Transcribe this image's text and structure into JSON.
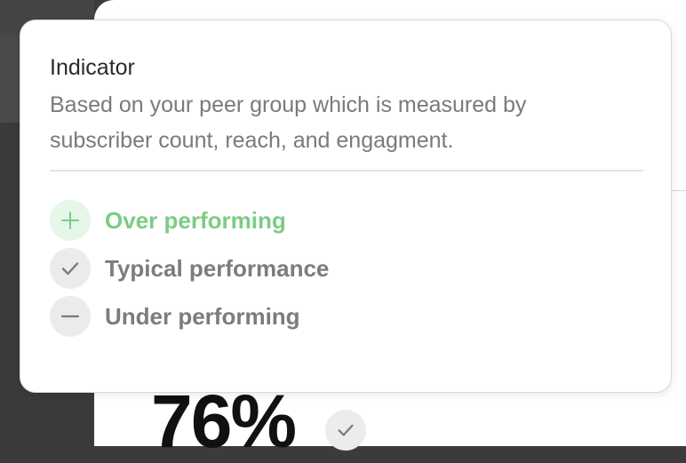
{
  "colors": {
    "over_performing": "#7ccc84",
    "over_performing_bg": "#e6f6e8",
    "neutral_text": "#7c7c7c",
    "neutral_bg": "#ebebeb"
  },
  "popover": {
    "title": "Indicator",
    "description": "Based on your peer group which is measured by subscriber count, reach, and engagment.",
    "items": [
      {
        "label": "Over performing",
        "icon": "plus-icon"
      },
      {
        "label": "Typical performance",
        "icon": "check-icon"
      },
      {
        "label": "Under performing",
        "icon": "minus-icon"
      }
    ]
  },
  "background": {
    "metric_value": "76%",
    "metric_icon": "check-icon"
  }
}
